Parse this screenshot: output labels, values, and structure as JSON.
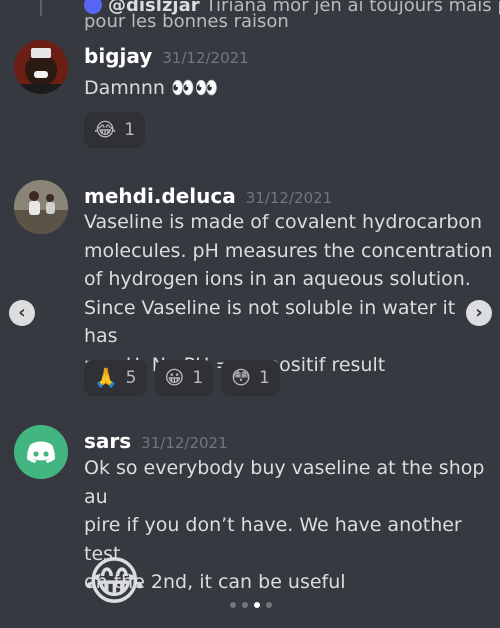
{
  "reply": {
    "username": "@dislzjar",
    "snippet": "Tiriana mor jen ai toujours mais pas",
    "continuation": "pour les bonnes raison"
  },
  "messages": [
    {
      "username": "bigjay",
      "timestamp": "31/12/2021",
      "text": "Damnnn 👀👀",
      "reactions": [
        {
          "emoji": "😂",
          "count": "1"
        }
      ]
    },
    {
      "username": "mehdi.deluca",
      "timestamp": "31/12/2021",
      "lines": [
        "Vaseline is made of covalent hydrocarbon",
        "molecules. pH measures the concentration",
        "of hydrogen ions in an aqueous solution.",
        "Since Vaseline is not soluble in water it has",
        "no pH. No PH = no positif result"
      ],
      "reactions": [
        {
          "emoji": "🙏",
          "count": "5"
        },
        {
          "emoji": "😀",
          "count": "1"
        },
        {
          "emoji": "😳",
          "count": "1"
        }
      ]
    },
    {
      "username": "sars",
      "timestamp": "31/12/2021",
      "lines": [
        "Ok so everybody buy vaseline at the shop au",
        "pire if you don’t have. We have another test",
        "on the 2nd, it can be useful"
      ],
      "big_emoji": "😂"
    }
  ],
  "nav": {
    "prev": "‹",
    "next": "›"
  },
  "colors": {
    "background": "#36393f",
    "reaction_bg": "#2f3136",
    "discord_avatar": "#43b581"
  }
}
